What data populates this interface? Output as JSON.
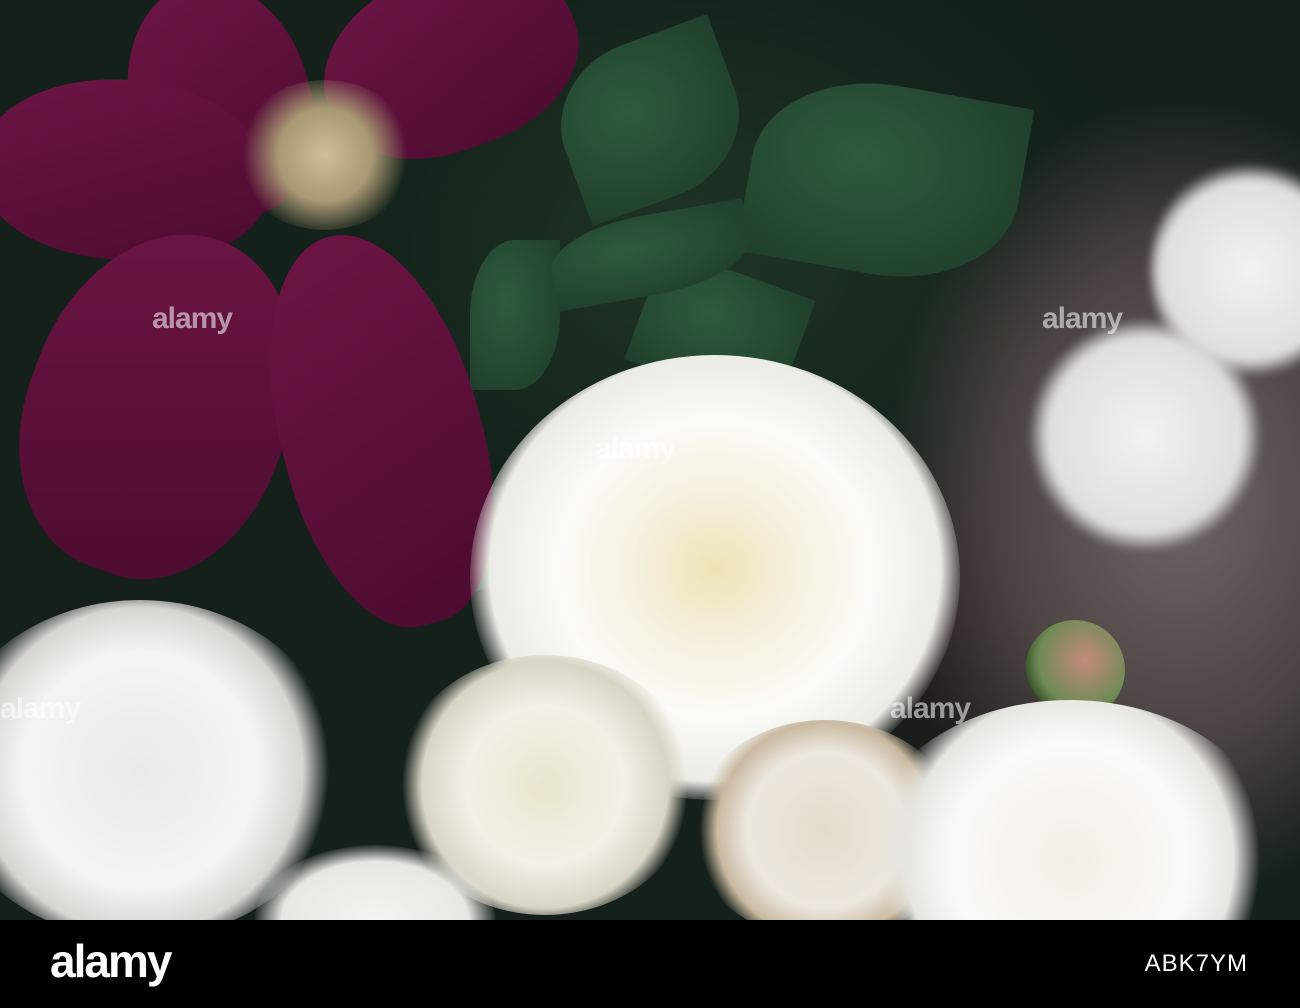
{
  "photo": {
    "subject": "White roses and purple clematis",
    "watermark_text": "alamy",
    "colors": {
      "clematis": "#5e0f3b",
      "leaf": "#2a4d36",
      "rose": "#f4f2ea",
      "rose_center": "#efe6c2"
    }
  },
  "footer": {
    "logo": "alamy",
    "image_code": "ABK7YM"
  }
}
